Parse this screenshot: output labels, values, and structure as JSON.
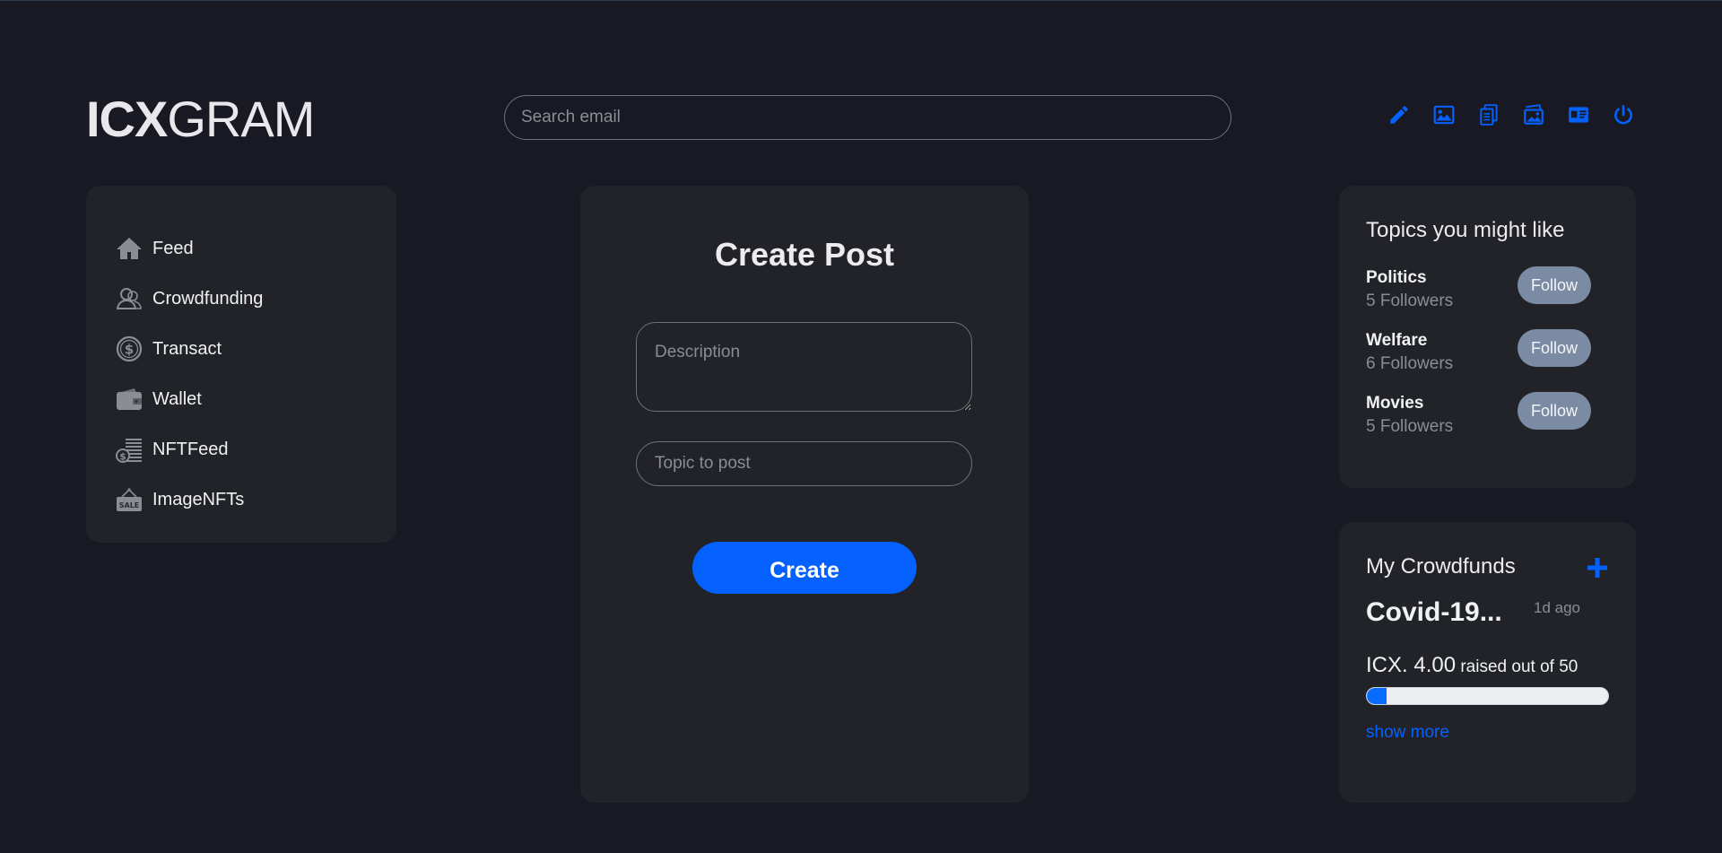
{
  "logo": {
    "bold": "ICX",
    "light": "GRAM"
  },
  "search": {
    "placeholder": "Search email"
  },
  "top_icons": [
    "pencil-icon",
    "image-icon",
    "documents-icon",
    "photo-stack-icon",
    "id-card-icon",
    "power-icon"
  ],
  "colors": {
    "accent": "#0561fd",
    "background": "#181922",
    "card": "#222328",
    "follow": "#7a8ba3"
  },
  "sidebar": {
    "items": [
      {
        "label": "Feed",
        "icon": "home-icon"
      },
      {
        "label": "Crowdfunding",
        "icon": "people-icon"
      },
      {
        "label": "Transact",
        "icon": "dollar-coin-icon"
      },
      {
        "label": "Wallet",
        "icon": "wallet-icon"
      },
      {
        "label": "NFTFeed",
        "icon": "coin-stack-icon"
      },
      {
        "label": "ImageNFTs",
        "icon": "sale-sign-icon"
      }
    ]
  },
  "create_post": {
    "title": "Create Post",
    "description_placeholder": "Description",
    "topic_placeholder": "Topic to post",
    "button": "Create"
  },
  "topics": {
    "title": "Topics you might like",
    "follow_label": "Follow",
    "items": [
      {
        "name": "Politics",
        "followers": "5 Followers"
      },
      {
        "name": "Welfare",
        "followers": "6 Followers"
      },
      {
        "name": "Movies",
        "followers": "5 Followers"
      }
    ]
  },
  "crowdfunds": {
    "title": "My Crowdfunds",
    "campaign": {
      "name": "Covid-19...",
      "time": "1d ago",
      "amount": "ICX. 4.00",
      "raised_text": "raised out of 50",
      "progress_fraction": 0.08
    },
    "show_more": "show more"
  }
}
